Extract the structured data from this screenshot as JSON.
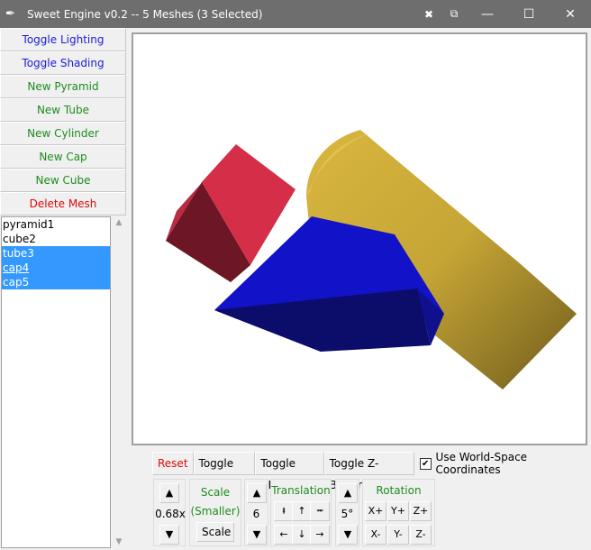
{
  "window": {
    "title": "Sweet Engine v0.2 -- 5 Meshes (3 Selected)",
    "icon": "feather-icon",
    "pin_icon": "✖",
    "restore_icon": "⧉",
    "minimize": "—",
    "maximize": "☐",
    "close": "✕"
  },
  "sidebar": {
    "buttons": [
      {
        "label": "Toggle Lighting",
        "color": "#1a1adc"
      },
      {
        "label": "Toggle Shading",
        "color": "#1a1adc"
      },
      {
        "label": "New Pyramid",
        "color": "#1e8c1e"
      },
      {
        "label": "New Tube",
        "color": "#1e8c1e"
      },
      {
        "label": "New Cylinder",
        "color": "#1e8c1e"
      },
      {
        "label": "New Cap",
        "color": "#1e8c1e"
      },
      {
        "label": "New Cube",
        "color": "#1e8c1e"
      },
      {
        "label": "Delete Mesh",
        "color": "#dc0a0a"
      }
    ],
    "meshes": [
      {
        "name": "pyramid1",
        "selected": false
      },
      {
        "name": "cube2",
        "selected": false
      },
      {
        "name": "tube3",
        "selected": true
      },
      {
        "name": "cap4",
        "selected": true
      },
      {
        "name": "cap5",
        "selected": true
      }
    ]
  },
  "toolbar": {
    "reset": "Reset",
    "toggle_fill": "Toggle Fill",
    "toggle_bfc": "Toggle BFC",
    "toggle_zbuffer": "Toggle Z-Buffer",
    "world_space": "Use World-Space Coordinates",
    "world_space_checked": true
  },
  "scale": {
    "up": "▲",
    "value": "0.68x",
    "down": "▼",
    "title": "Scale",
    "subtitle": "(Smaller)",
    "button": "Scale"
  },
  "translation": {
    "up": "▲",
    "value": "6",
    "down": "▼",
    "title": "Translation",
    "btn_a": "⭻",
    "btn_up": "↑",
    "btn_b": "⭺",
    "btn_left": "←",
    "btn_down": "↓",
    "btn_right": "→"
  },
  "rotation": {
    "up": "▲",
    "value": "5°",
    "down": "▼",
    "title": "Rotation",
    "xp": "X+",
    "yp": "Y+",
    "zp": "Z+",
    "xm": "X-",
    "ym": "Y-",
    "zm": "Z-"
  },
  "colors": {
    "cube": "#d02f48",
    "pyramid": "#1414d0",
    "cylinder": "#c8a837"
  }
}
